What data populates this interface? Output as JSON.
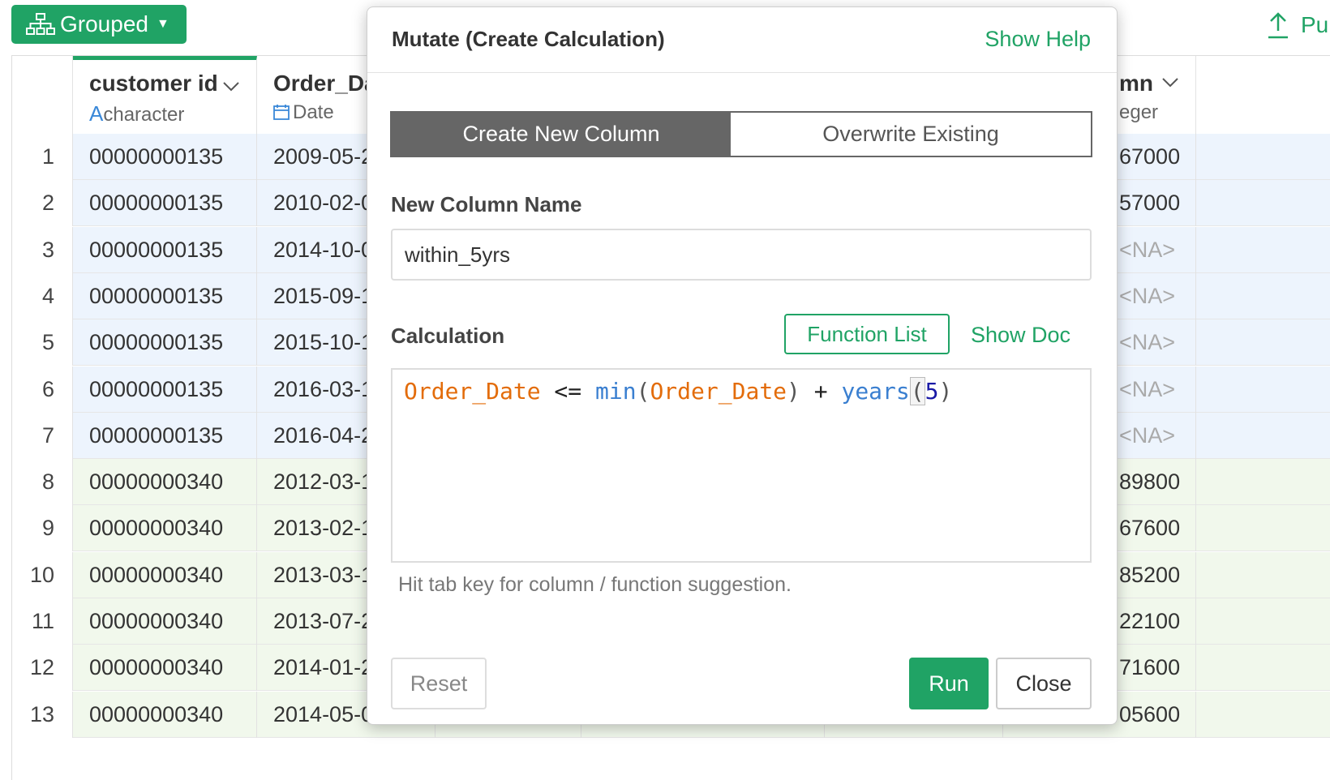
{
  "toolbar": {
    "grouped_label": "Grouped",
    "publish_label": "Pu"
  },
  "table": {
    "columns": [
      {
        "name": "customer id",
        "type": "character",
        "type_icon": "A"
      },
      {
        "name": "Order_Da",
        "type": "Date"
      },
      {
        "name": "mn",
        "type": "eger"
      }
    ],
    "rows": [
      {
        "n": "1",
        "customer_id": "00000000135",
        "order_date": "2009-05-2",
        "last": "67000",
        "group": "blue"
      },
      {
        "n": "2",
        "customer_id": "00000000135",
        "order_date": "2010-02-0",
        "last": "57000",
        "group": "blue"
      },
      {
        "n": "3",
        "customer_id": "00000000135",
        "order_date": "2014-10-0",
        "last": "<NA>",
        "group": "blue"
      },
      {
        "n": "4",
        "customer_id": "00000000135",
        "order_date": "2015-09-1",
        "last": "<NA>",
        "group": "blue"
      },
      {
        "n": "5",
        "customer_id": "00000000135",
        "order_date": "2015-10-1",
        "last": "<NA>",
        "group": "blue"
      },
      {
        "n": "6",
        "customer_id": "00000000135",
        "order_date": "2016-03-1",
        "last": "<NA>",
        "group": "blue"
      },
      {
        "n": "7",
        "customer_id": "00000000135",
        "order_date": "2016-04-2",
        "last": "<NA>",
        "group": "blue"
      },
      {
        "n": "8",
        "customer_id": "00000000340",
        "order_date": "2012-03-1",
        "last": "89800",
        "group": "green"
      },
      {
        "n": "9",
        "customer_id": "00000000340",
        "order_date": "2013-02-1",
        "last": "67600",
        "group": "green"
      },
      {
        "n": "10",
        "customer_id": "00000000340",
        "order_date": "2013-03-1",
        "last": "85200",
        "group": "green"
      },
      {
        "n": "11",
        "customer_id": "00000000340",
        "order_date": "2013-07-2",
        "last": "22100",
        "group": "green"
      },
      {
        "n": "12",
        "customer_id": "00000000340",
        "order_date": "2014-01-2",
        "last": "71600",
        "group": "green"
      },
      {
        "n": "13",
        "customer_id": "00000000340",
        "order_date": "2014-05-0",
        "last": "05600",
        "group": "green"
      }
    ]
  },
  "modal": {
    "title": "Mutate (Create Calculation)",
    "show_help": "Show Help",
    "tabs": [
      "Create New Column",
      "Overwrite Existing"
    ],
    "active_tab": "Create New Column",
    "new_column_label": "New Column Name",
    "new_column_value": "within_5yrs",
    "calculation_label": "Calculation",
    "function_list": "Function List",
    "show_doc": "Show Doc",
    "calc": {
      "col1": "Order_Date",
      "op1": " <= ",
      "fn1": "min",
      "p1": "(",
      "col2": "Order_Date",
      "p2": ")",
      "op2": " + ",
      "fn2": "years",
      "p3": "(",
      "num": "5",
      "p4": ")"
    },
    "hint": "Hit tab key for column / function suggestion.",
    "reset": "Reset",
    "run": "Run",
    "close": "Close"
  },
  "colors": {
    "accent": "#20a365",
    "group_blue": "#edf4fd",
    "group_green": "#f1f8ec",
    "segment_active": "#666666"
  }
}
